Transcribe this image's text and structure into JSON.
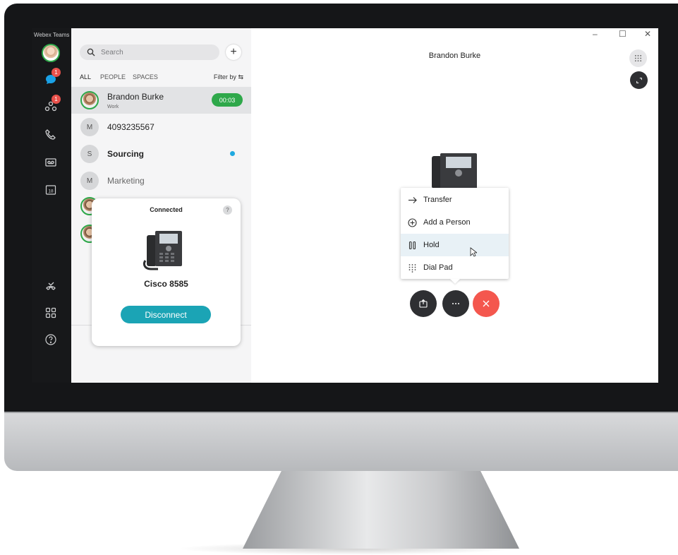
{
  "app": {
    "title": "Webex Teams"
  },
  "rail": {
    "messages_badge": "1",
    "teams_badge": "1",
    "calendar_day": "18"
  },
  "search": {
    "placeholder": "Search"
  },
  "filters": {
    "all": "ALL",
    "people": "PEOPLE",
    "spaces": "SPACES",
    "filter_by": "Filter by"
  },
  "contacts": [
    {
      "name": "Brandon Burke",
      "sub": "Work",
      "timer": "00:03"
    },
    {
      "initial": "M",
      "name": "4093235567"
    },
    {
      "initial": "S",
      "name": "Sourcing"
    },
    {
      "initial": "M",
      "name": "Marketing"
    }
  ],
  "card": {
    "title": "Connected",
    "help": "?",
    "device": "Cisco 8585",
    "button": "Disconnect"
  },
  "call": {
    "title": "Brandon Burke"
  },
  "window_controls": {
    "minimize": "–",
    "maximize": "☐",
    "close": "✕"
  },
  "menu": {
    "items": [
      "Transfer",
      "Add a Person",
      "Hold",
      "Dial Pad"
    ]
  },
  "colors": {
    "accent_green": "#2ea84a",
    "accent_teal": "#1ba4b5",
    "end_call": "#f4574e",
    "unread_dot": "#1fa9e0",
    "badge": "#e8514b"
  }
}
